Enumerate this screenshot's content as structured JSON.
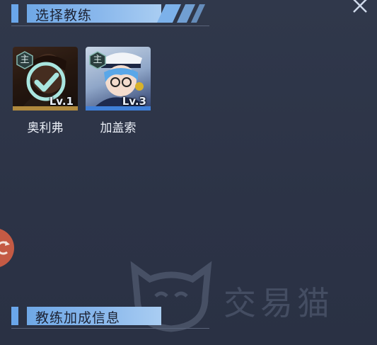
{
  "header_top": {
    "title": "选择教练"
  },
  "header_bottom": {
    "title": "教练加成信息"
  },
  "close_icon": "close-icon",
  "coaches": [
    {
      "name": "奥利弗",
      "role_badge": "主",
      "level": "Lv.1",
      "selected": true,
      "frame_color": "#b08a3e"
    },
    {
      "name": "加盖索",
      "role_badge": "主",
      "level": "Lv.3",
      "selected": false,
      "frame_color": "#3f7fd8"
    }
  ],
  "watermark": {
    "text": "交易猫",
    "icon": "cat-logo"
  },
  "colors": {
    "accent": "#6fa8e6",
    "background": "#2f3649",
    "check": "#a9e6e0"
  }
}
